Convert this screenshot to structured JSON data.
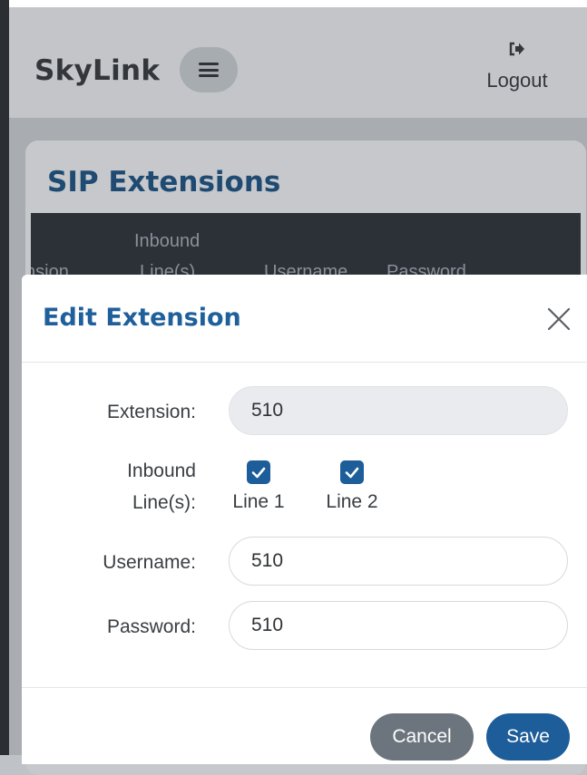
{
  "header": {
    "brand": "SkyLink",
    "logout_label": "Logout"
  },
  "page": {
    "title": "SIP Extensions",
    "columns": [
      "nsion",
      "Inbound",
      "Line(s)",
      "Username",
      "Password"
    ]
  },
  "modal": {
    "title": "Edit Extension",
    "fields": {
      "extension": {
        "label": "Extension:",
        "value": "510"
      },
      "inbound": {
        "label_line1": "Inbound",
        "label_line2": "Line(s):"
      },
      "username": {
        "label": "Username:",
        "value": "510"
      },
      "password": {
        "label": "Password:",
        "value": "510"
      }
    },
    "lines": [
      {
        "label": "Line 1",
        "checked": true
      },
      {
        "label": "Line 2",
        "checked": true
      }
    ],
    "buttons": {
      "cancel": "Cancel",
      "save": "Save"
    }
  },
  "icons": {
    "menu": "hamburger-icon",
    "logout": "sign-out-icon",
    "close": "close-icon",
    "check": "check-icon"
  },
  "colors": {
    "primary": "#1d5d99",
    "secondary": "#6c757d",
    "title": "#1f5f9b"
  }
}
